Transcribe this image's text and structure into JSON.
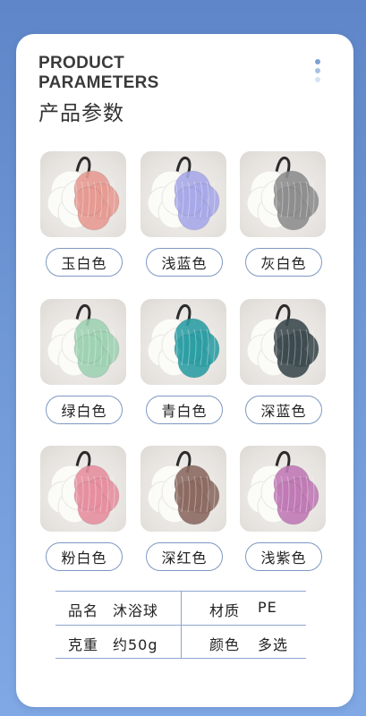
{
  "header": {
    "title_en": "PRODUCT\nPARAMETERS",
    "title_cn": "产品参数",
    "dots_colors": [
      "#7fa2d6",
      "#a9c0e4",
      "#d7e2f3"
    ]
  },
  "colors": [
    {
      "label": "玉白色",
      "accent": "#e59a92"
    },
    {
      "label": "浅蓝色",
      "accent": "#a7a8e8"
    },
    {
      "label": "灰白色",
      "accent": "#8e8e8e"
    },
    {
      "label": "绿白色",
      "accent": "#9fd1b2"
    },
    {
      "label": "青白色",
      "accent": "#2d9ea4"
    },
    {
      "label": "深蓝色",
      "accent": "#3d4a4f"
    },
    {
      "label": "粉白色",
      "accent": "#e58fa0"
    },
    {
      "label": "深红色",
      "accent": "#8c6a62"
    },
    {
      "label": "浅紫色",
      "accent": "#c07ab5"
    }
  ],
  "specs": {
    "name_label": "品名",
    "name_value": "沐浴球",
    "material_label": "材质",
    "material_value": "PE",
    "weight_label": "克重",
    "weight_value": "约50g",
    "color_label": "颜色",
    "color_value": "多选"
  }
}
